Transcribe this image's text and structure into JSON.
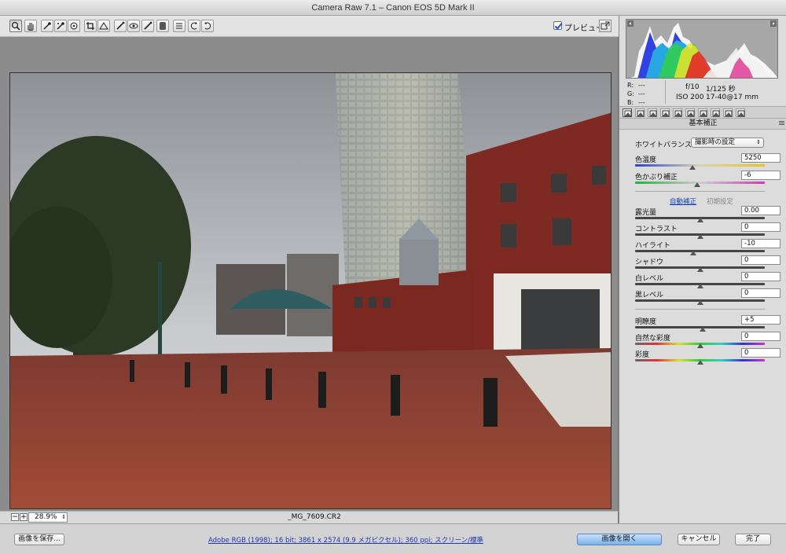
{
  "window": {
    "title": "Camera Raw 7.1  –  Canon EOS 5D Mark II"
  },
  "toolbar": {
    "tools": [
      {
        "name": "zoom-tool",
        "icon": "magnifier-icon"
      },
      {
        "name": "hand-tool",
        "icon": "hand-icon"
      },
      {
        "name": "white-balance-tool",
        "icon": "eyedropper-icon"
      },
      {
        "name": "color-sampler-tool",
        "icon": "sampler-icon"
      },
      {
        "name": "target-adjustment-tool",
        "icon": "target-icon"
      },
      {
        "name": "crop-tool",
        "icon": "crop-icon"
      },
      {
        "name": "straighten-tool",
        "icon": "straighten-icon"
      },
      {
        "name": "spot-removal-tool",
        "icon": "brush-icon"
      },
      {
        "name": "red-eye-tool",
        "icon": "eye-icon"
      },
      {
        "name": "adjustment-brush-tool",
        "icon": "brush-icon"
      },
      {
        "name": "graduated-filter-tool",
        "icon": "gradient-icon"
      },
      {
        "name": "preferences-tool",
        "icon": "list-icon"
      },
      {
        "name": "rotate-ccw-tool",
        "icon": "rotate-left-icon"
      },
      {
        "name": "rotate-cw-tool",
        "icon": "rotate-right-icon"
      }
    ],
    "preview_label": "プレビュー",
    "preview_checked": true
  },
  "status": {
    "zoom": "28.9%",
    "filename": "_MG_7609.CR2"
  },
  "histogram": {
    "rgb": [
      {
        "label": "R:",
        "value": "---"
      },
      {
        "label": "G:",
        "value": "---"
      },
      {
        "label": "B:",
        "value": "---"
      }
    ],
    "aperture": "f/10",
    "shutter": "1/125 秒",
    "iso": "ISO 200",
    "lens": "17-40@17 mm"
  },
  "panel": {
    "title": "基本補正",
    "white_balance_label": "ホワイトバランス :",
    "white_balance_value": "撮影時の設定",
    "auto": "自動補正",
    "default": "初期設定",
    "sliders_top": [
      {
        "label": "色温度",
        "value": "5250",
        "pos": 0.44,
        "track": "temp"
      },
      {
        "label": "色かぶり補正",
        "value": "-6",
        "pos": 0.48,
        "track": "tint"
      }
    ],
    "sliders_tone": [
      {
        "label": "露光量",
        "value": "0.00",
        "pos": 0.5,
        "track": "dark"
      },
      {
        "label": "コントラスト",
        "value": "0",
        "pos": 0.5,
        "track": "dark"
      },
      {
        "label": "ハイライト",
        "value": "-10",
        "pos": 0.45,
        "track": "dark"
      },
      {
        "label": "シャドウ",
        "value": "0",
        "pos": 0.5,
        "track": "dark"
      },
      {
        "label": "白レベル",
        "value": "0",
        "pos": 0.5,
        "track": "dark"
      },
      {
        "label": "黒レベル",
        "value": "0",
        "pos": 0.5,
        "track": "dark"
      }
    ],
    "sliders_presence": [
      {
        "label": "明瞭度",
        "value": "+5",
        "pos": 0.52,
        "track": "dark"
      },
      {
        "label": "自然な彩度",
        "value": "0",
        "pos": 0.5,
        "track": "rainbow"
      },
      {
        "label": "彩度",
        "value": "0",
        "pos": 0.5,
        "track": "rainbow"
      }
    ]
  },
  "footer": {
    "save_label": "画像を保存...",
    "workflow": "Adobe RGB (1998); 16 bit; 3861 x 2574 (9.9 メガピクセル); 360 ppi; スクリーン/標準",
    "open_label": "画像を開く",
    "cancel_label": "キャンセル",
    "done_label": "完了"
  }
}
